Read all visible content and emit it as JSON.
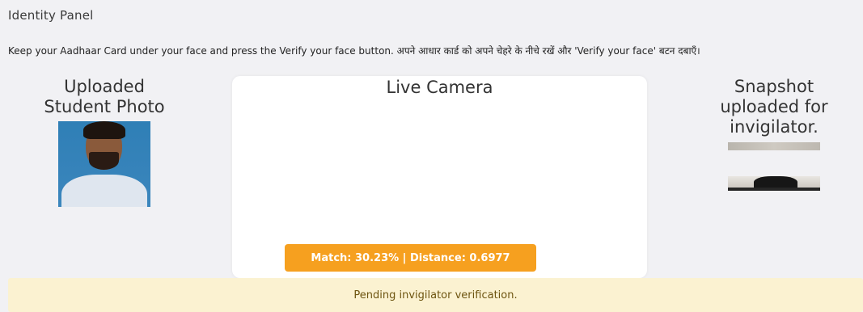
{
  "panel": {
    "title": "Identity Panel",
    "instructions": "Keep your Aadhaar Card under your face and press the Verify your face button. अपने आधार कार्ड को अपने चेहरे के नीचे रखें और 'Verify your face' बटन दबाएँ।"
  },
  "uploaded": {
    "title_line1": "Uploaded",
    "title_line2": "Student Photo"
  },
  "camera": {
    "title": "Live Camera",
    "match_label": "Match: 30.23% | Distance: 0.6977"
  },
  "snapshot": {
    "title_line1": "Snapshot",
    "title_line2": "uploaded for",
    "title_line3": "invigilator."
  },
  "status": {
    "message": "Pending invigilator verification."
  },
  "colors": {
    "badge": "#f6a01f",
    "status_bg": "#fbf2d1",
    "status_text": "#6d5410",
    "page_bg": "#f1f1f4"
  }
}
